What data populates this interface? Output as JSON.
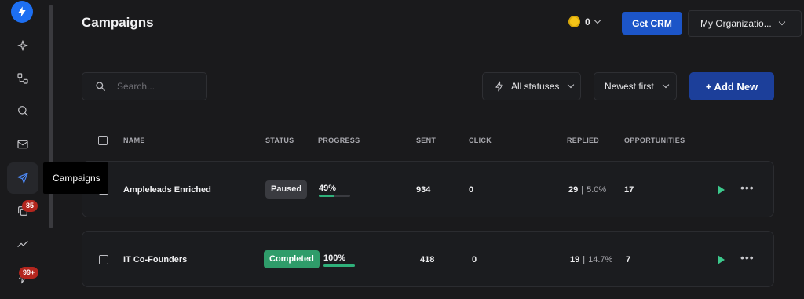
{
  "sidebar": {
    "badges": {
      "inbox_count": "85",
      "notifications_count": "99+"
    },
    "tooltip": "Campaigns"
  },
  "header": {
    "title": "Campaigns",
    "credits": "0",
    "get_crm_label": "Get CRM",
    "organization": "My Organizatio..."
  },
  "toolbar": {
    "search_placeholder": "Search...",
    "status_filter": "All statuses",
    "sort": "Newest first",
    "add_new_label": "+ Add New"
  },
  "table": {
    "columns": [
      "NAME",
      "STATUS",
      "PROGRESS",
      "SENT",
      "CLICK",
      "REPLIED",
      "OPPORTUNITIES"
    ],
    "rows": [
      {
        "name": "Ampleleads Enriched",
        "status": "Paused",
        "progress": "49%",
        "progress_value": 0.49,
        "sent": "934",
        "click": "0",
        "replied": "29",
        "replied_pct": "5.0%",
        "opportunities": "17"
      },
      {
        "name": "IT Co-Founders",
        "status": "Completed",
        "progress": "100%",
        "progress_value": 1.0,
        "sent": "418",
        "click": "0",
        "replied": "19",
        "replied_pct": "14.7%",
        "opportunities": "7"
      }
    ]
  },
  "colors": {
    "primary": "#1c55c8",
    "add_button": "#1c3f9a",
    "success": "#2f9c6a",
    "progress": "#2fb07a",
    "badge": "#b3261e"
  }
}
